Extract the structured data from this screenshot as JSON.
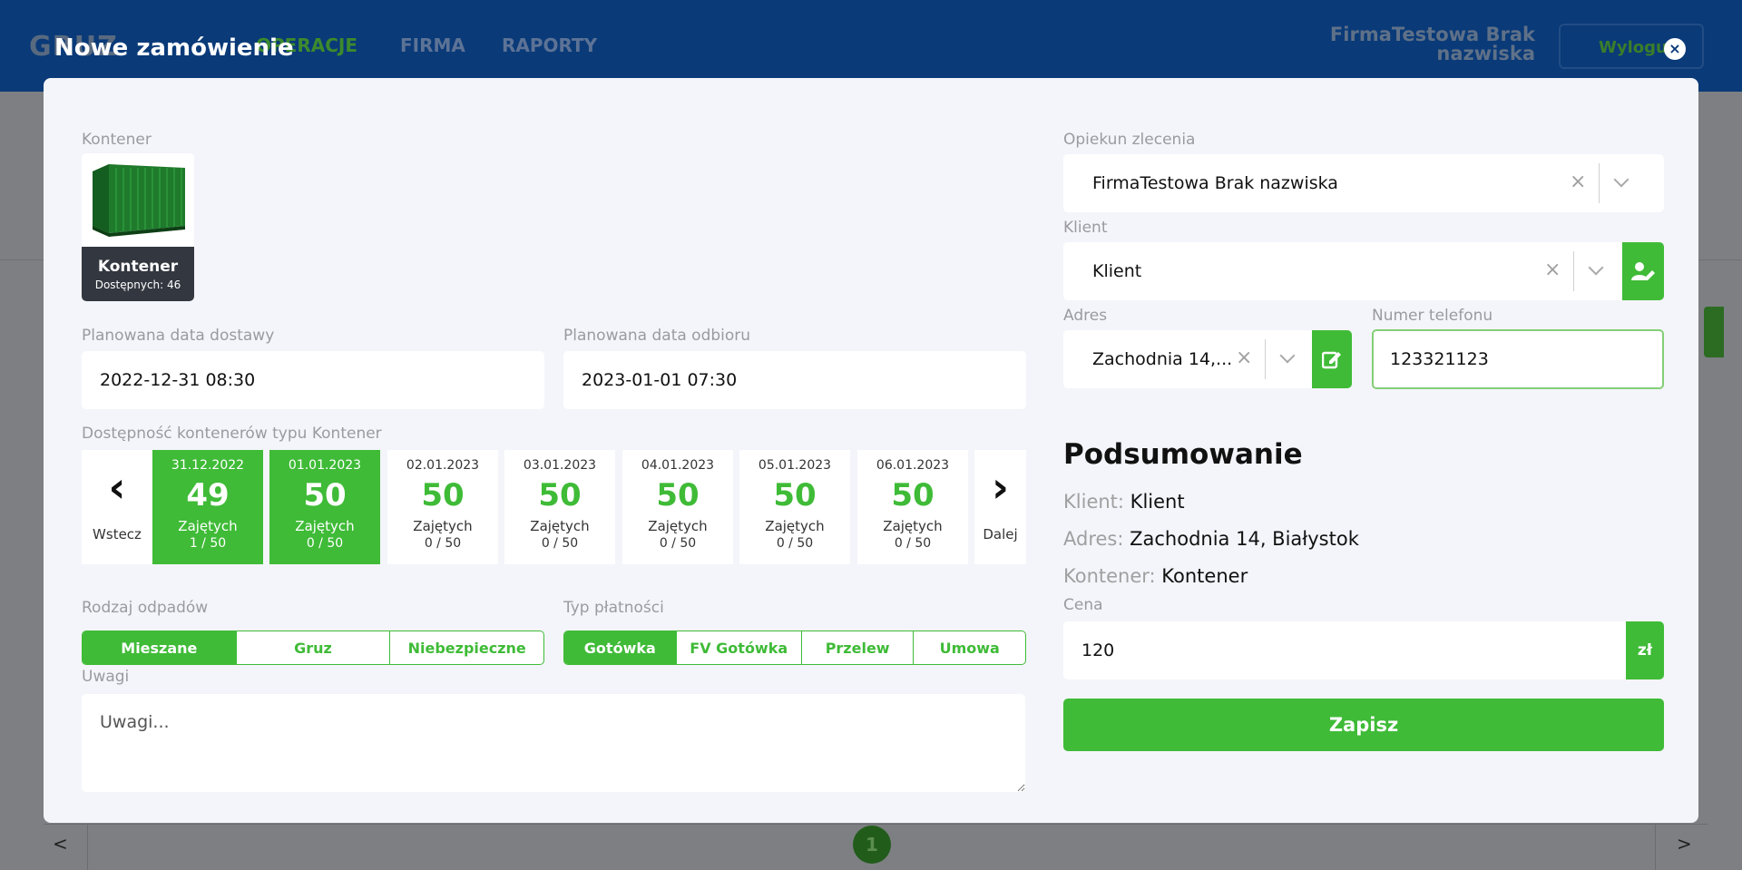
{
  "background": {
    "logo": "GRUZ",
    "nav": [
      "OPERACJE",
      "FIRMA",
      "RAPORTY"
    ],
    "user_line1": "FirmaTestowa Brak",
    "user_line2": "nazwiska",
    "logout": "Wyloguj",
    "pager_prev": "<",
    "pager_next": ">",
    "page_number": "1"
  },
  "modal": {
    "title": "Nowe zamówienie",
    "close": "×"
  },
  "container": {
    "label": "Kontener",
    "name": "Kontener",
    "available": "Dostępnych: 46"
  },
  "dates": {
    "delivery_label": "Planowana data dostawy",
    "delivery_value": "2022-12-31 08:30",
    "pickup_label": "Planowana data odbioru",
    "pickup_value": "2023-01-01 07:30"
  },
  "availability": {
    "label": "Dostępność kontenerów typu Kontener",
    "prev_label": "Wstecz",
    "next_label": "Dalej",
    "days": [
      {
        "date": "31.12.2022",
        "count": "49",
        "occupied_label": "Zajętych",
        "ratio": "1 / 50",
        "full": true
      },
      {
        "date": "01.01.2023",
        "count": "50",
        "occupied_label": "Zajętych",
        "ratio": "0 / 50",
        "full": true
      },
      {
        "date": "02.01.2023",
        "count": "50",
        "occupied_label": "Zajętych",
        "ratio": "0 / 50",
        "full": false
      },
      {
        "date": "03.01.2023",
        "count": "50",
        "occupied_label": "Zajętych",
        "ratio": "0 / 50",
        "full": false
      },
      {
        "date": "04.01.2023",
        "count": "50",
        "occupied_label": "Zajętych",
        "ratio": "0 / 50",
        "full": false
      },
      {
        "date": "05.01.2023",
        "count": "50",
        "occupied_label": "Zajętych",
        "ratio": "0 / 50",
        "full": false
      },
      {
        "date": "06.01.2023",
        "count": "50",
        "occupied_label": "Zajętych",
        "ratio": "0 / 50",
        "full": false
      }
    ]
  },
  "waste": {
    "label": "Rodzaj odpadów",
    "options": [
      "Mieszane",
      "Gruz",
      "Niebezpieczne"
    ],
    "selected": "Mieszane"
  },
  "payment": {
    "label": "Typ płatności",
    "options": [
      "Gotówka",
      "FV Gotówka",
      "Przelew",
      "Umowa"
    ],
    "selected": "Gotówka"
  },
  "notes": {
    "label": "Uwagi",
    "placeholder": "Uwagi..."
  },
  "supervisor": {
    "label": "Opiekun zlecenia",
    "value": "FirmaTestowa Brak nazwiska"
  },
  "client": {
    "label": "Klient",
    "value": "Klient"
  },
  "address": {
    "label": "Adres",
    "value": "Zachodnia 14,..."
  },
  "phone": {
    "label": "Numer telefonu",
    "value": "123321123"
  },
  "summary": {
    "title": "Podsumowanie",
    "client_key": "Klient:",
    "client_value": "Klient",
    "address_key": "Adres:",
    "address_value": "Zachodnia 14, Białystok",
    "container_key": "Kontener:",
    "container_value": "Kontener",
    "price_label": "Cena",
    "price_value": "120",
    "currency": "zł",
    "save": "Zapisz"
  },
  "colors": {
    "accent": "#3fbb37",
    "header": "#0a3a78",
    "modal_bg": "#f4f5fa"
  }
}
